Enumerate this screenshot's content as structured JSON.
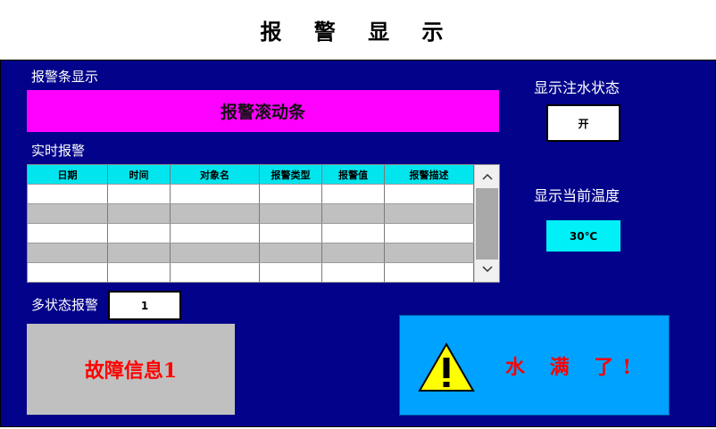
{
  "title": "报 警 显 示",
  "alarm_bar": {
    "label": "报警条显示",
    "marquee_text": "报警滚动条"
  },
  "realtime": {
    "label": "实时报警",
    "columns": [
      "日期",
      "时间",
      "对象名",
      "报警类型",
      "报警值",
      "报警描述"
    ],
    "scroll_up": "⌃",
    "scroll_down": "⌄"
  },
  "water_status": {
    "label": "显示注水状态",
    "value": "开"
  },
  "temperature": {
    "label": "显示当前温度",
    "value": "30℃"
  },
  "multi_state": {
    "label": "多状态报警",
    "value": "1"
  },
  "fault_info": "故障信息1",
  "water_full_msg": "水 满 了!",
  "colors": {
    "panel_bg": "#02028a",
    "marquee_bg": "#ff00ff",
    "table_header_bg": "#00e5ee",
    "temp_bg": "#00f0f8",
    "fault_bg": "#c0c0c0",
    "water_bg": "#00a2ff",
    "alarm_text": "#ff0000"
  },
  "icons": {
    "warning": "warning-triangle-icon"
  }
}
